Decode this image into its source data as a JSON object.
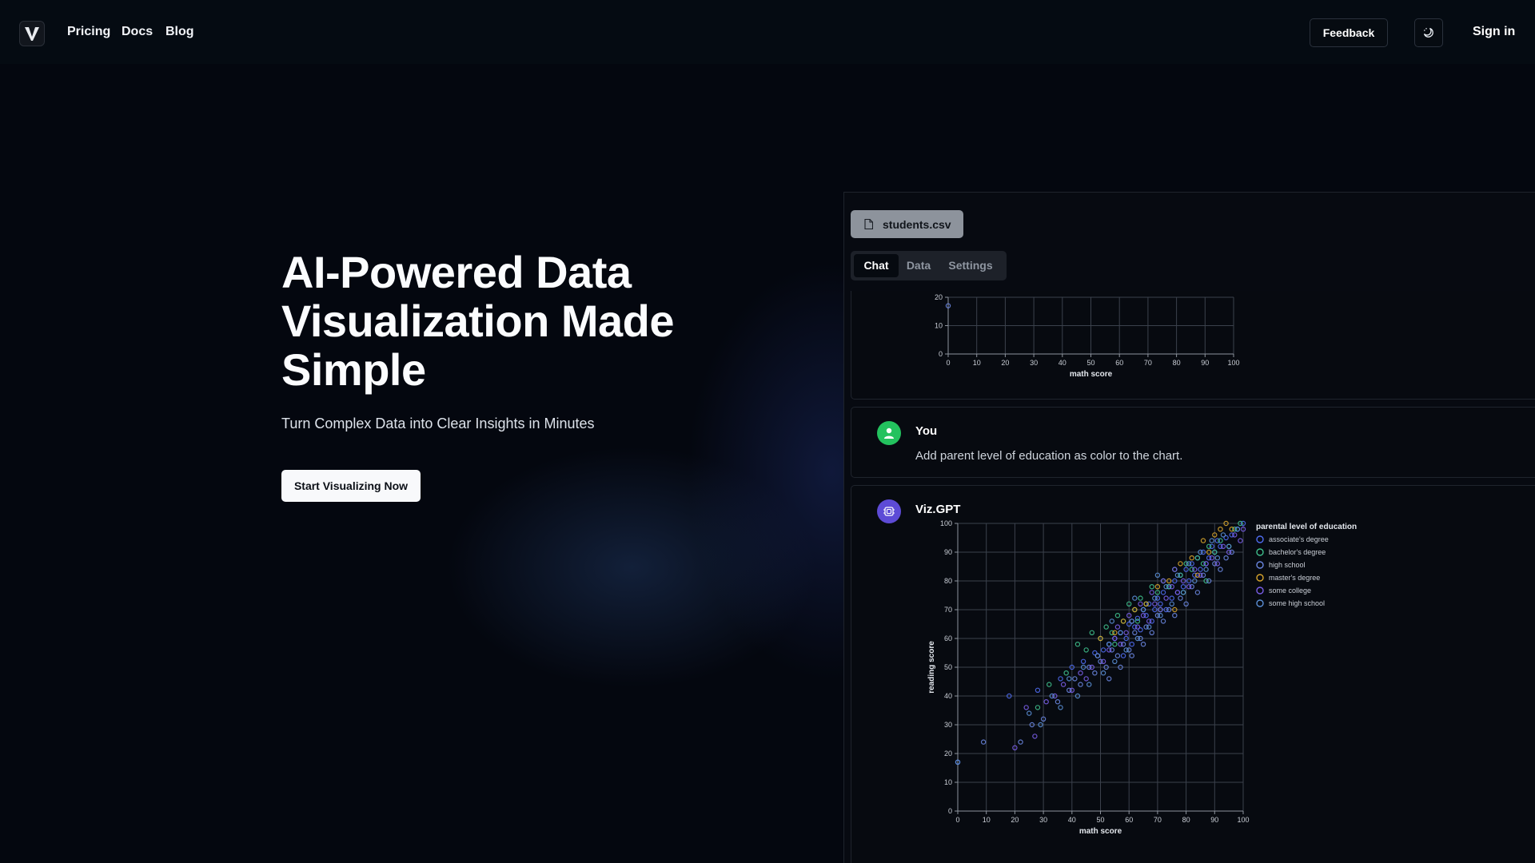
{
  "nav": {
    "links": [
      "Pricing",
      "Docs",
      "Blog"
    ],
    "feedback_label": "Feedback",
    "sign_in_label": "Sign in"
  },
  "hero": {
    "title_lines": [
      "AI-Powered Data",
      "Visualization Made",
      "Simple"
    ],
    "subtitle": "Turn Complex Data into Clear Insights in Minutes",
    "cta_label": "Start Visualizing Now"
  },
  "app": {
    "file_name": "students.csv",
    "tabs": [
      {
        "label": "Chat",
        "active": true
      },
      {
        "label": "Data",
        "active": false
      },
      {
        "label": "Settings",
        "active": false
      }
    ],
    "messages": [
      {
        "sender": "You",
        "text": "Add parent level of education as color to the chart."
      },
      {
        "sender": "Viz.GPT",
        "text": ""
      }
    ]
  },
  "colors": {
    "you_avatar": "#23c25e",
    "ai_avatar": "#5d4bd6"
  },
  "chart_data": [
    {
      "type": "scatter",
      "title": "",
      "xlabel": "math score",
      "ylabel": "",
      "xlim": [
        0,
        100
      ],
      "ylim": [
        0,
        20
      ],
      "x_ticks": [
        0,
        10,
        20,
        30,
        40,
        50,
        60,
        70,
        80,
        90,
        100
      ],
      "y_ticks": [
        0,
        10,
        20
      ],
      "grid": true,
      "series": [
        {
          "x": [
            0
          ],
          "y": [
            17
          ],
          "color": "#6a86e0"
        }
      ]
    },
    {
      "type": "scatter",
      "title": "",
      "xlabel": "math score",
      "ylabel": "reading score",
      "xlim": [
        0,
        100
      ],
      "ylim": [
        0,
        100
      ],
      "x_ticks": [
        0,
        10,
        20,
        30,
        40,
        50,
        60,
        70,
        80,
        90,
        100
      ],
      "y_ticks": [
        0,
        10,
        20,
        30,
        40,
        50,
        60,
        70,
        80,
        90,
        100
      ],
      "grid": true,
      "legend_title": "parental level of education",
      "legend_position": "right",
      "series": [
        {
          "name": "associate's degree",
          "color": "#4f6cf0",
          "x": [
            0,
            18,
            28,
            36,
            40,
            44,
            48,
            51,
            53,
            55,
            57,
            59,
            60,
            62,
            63,
            64,
            65,
            66,
            67,
            68,
            69,
            70,
            71,
            72,
            73,
            74,
            75,
            76,
            77,
            78,
            79,
            80,
            81,
            82,
            83,
            84,
            85,
            86,
            87,
            88,
            89,
            90,
            91,
            92,
            94,
            96,
            98,
            100,
            58,
            61
          ],
          "y": [
            17,
            40,
            42,
            46,
            50,
            52,
            55,
            56,
            58,
            60,
            62,
            60,
            65,
            64,
            67,
            63,
            70,
            68,
            72,
            66,
            70,
            74,
            72,
            76,
            70,
            78,
            74,
            80,
            76,
            82,
            78,
            84,
            80,
            86,
            82,
            88,
            84,
            90,
            86,
            88,
            92,
            90,
            94,
            92,
            95,
            96,
            98,
            100,
            54,
            58
          ]
        },
        {
          "name": "bachelor's degree",
          "color": "#3fbf8c",
          "x": [
            28,
            32,
            38,
            42,
            45,
            47,
            50,
            52,
            54,
            56,
            58,
            60,
            62,
            64,
            66,
            68,
            70,
            72,
            74,
            76,
            78,
            80,
            82,
            84,
            86,
            88,
            90,
            92,
            95,
            97,
            99,
            55,
            63,
            71,
            79,
            87
          ],
          "y": [
            36,
            44,
            48,
            58,
            56,
            62,
            60,
            64,
            62,
            68,
            66,
            72,
            70,
            74,
            72,
            78,
            76,
            80,
            78,
            84,
            82,
            86,
            84,
            88,
            86,
            92,
            90,
            94,
            92,
            98,
            100,
            58,
            66,
            70,
            76,
            80
          ]
        },
        {
          "name": "high school",
          "color": "#6a86e0",
          "x": [
            9,
            22,
            26,
            30,
            35,
            39,
            41,
            43,
            46,
            48,
            50,
            52,
            54,
            56,
            58,
            60,
            62,
            64,
            66,
            68,
            70,
            72,
            74,
            76,
            78,
            80,
            82,
            84,
            86,
            88,
            90,
            92,
            94,
            96,
            53,
            57,
            61,
            65
          ],
          "y": [
            24,
            24,
            30,
            32,
            38,
            42,
            46,
            44,
            50,
            48,
            52,
            50,
            56,
            54,
            58,
            56,
            62,
            60,
            64,
            62,
            68,
            66,
            70,
            68,
            74,
            72,
            78,
            76,
            82,
            80,
            86,
            84,
            88,
            90,
            46,
            50,
            54,
            58
          ]
        },
        {
          "name": "master's degree",
          "color": "#d8a52c",
          "x": [
            50,
            55,
            58,
            62,
            66,
            70,
            74,
            78,
            82,
            86,
            88,
            90,
            92,
            94,
            96,
            76,
            84
          ],
          "y": [
            60,
            62,
            66,
            70,
            72,
            78,
            80,
            86,
            88,
            94,
            90,
            96,
            98,
            100,
            98,
            70,
            82
          ]
        },
        {
          "name": "some college",
          "color": "#7a5ee8",
          "x": [
            20,
            24,
            27,
            31,
            34,
            37,
            40,
            43,
            45,
            47,
            49,
            51,
            53,
            55,
            57,
            59,
            61,
            63,
            65,
            67,
            69,
            71,
            73,
            75,
            77,
            79,
            81,
            83,
            85,
            87,
            89,
            91,
            93,
            95,
            97,
            99,
            100,
            56,
            60,
            64,
            68,
            72,
            76
          ],
          "y": [
            22,
            36,
            26,
            38,
            40,
            44,
            42,
            48,
            46,
            50,
            54,
            52,
            56,
            60,
            58,
            62,
            66,
            64,
            68,
            66,
            72,
            70,
            74,
            78,
            76,
            80,
            78,
            84,
            82,
            86,
            88,
            86,
            92,
            90,
            96,
            94,
            98,
            64,
            68,
            72,
            76,
            80,
            84
          ]
        },
        {
          "name": "some high school",
          "color": "#5b8fd6",
          "x": [
            0,
            25,
            29,
            33,
            36,
            39,
            42,
            44,
            46,
            49,
            51,
            53,
            55,
            57,
            59,
            61,
            63,
            65,
            67,
            69,
            71,
            73,
            75,
            77,
            79,
            81,
            83,
            85,
            87,
            89,
            91,
            93,
            95,
            98,
            54,
            62,
            70
          ],
          "y": [
            17,
            34,
            30,
            40,
            36,
            46,
            40,
            50,
            44,
            54,
            48,
            58,
            52,
            62,
            56,
            66,
            60,
            70,
            64,
            74,
            68,
            78,
            72,
            82,
            76,
            86,
            80,
            90,
            84,
            94,
            88,
            96,
            92,
            98,
            66,
            74,
            82
          ]
        }
      ]
    }
  ]
}
